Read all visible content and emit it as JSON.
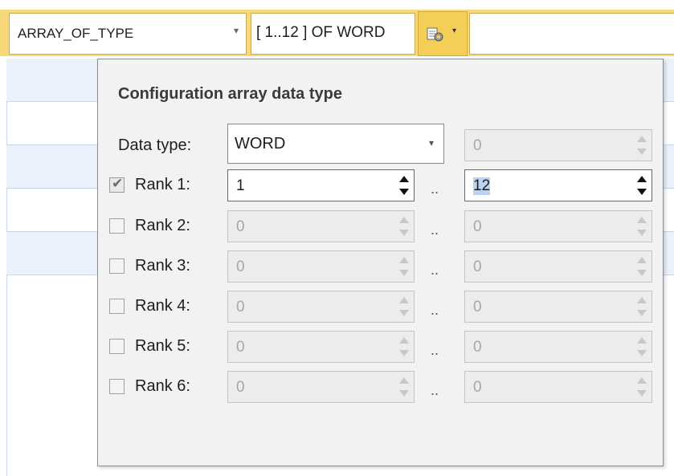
{
  "toolbar": {
    "type_value": "ARRAY_OF_TYPE",
    "type_arrow": "▾",
    "summary_value": "[ 1..12 ] OF WORD",
    "config_icon": "array-config-icon",
    "config_arrow": "▾"
  },
  "popup": {
    "title": "Configuration array data type",
    "data_type_label": "Data type:",
    "data_type_value": "WORD",
    "data_type_arrow": "▾",
    "data_type_extra_value": "0",
    "range_separator": "..",
    "ranks": [
      {
        "label": "Rank 1:",
        "checked": true,
        "lower": "1",
        "upper": "12"
      },
      {
        "label": "Rank 2:",
        "checked": false,
        "lower": "0",
        "upper": "0"
      },
      {
        "label": "Rank 3:",
        "checked": false,
        "lower": "0",
        "upper": "0"
      },
      {
        "label": "Rank 4:",
        "checked": false,
        "lower": "0",
        "upper": "0"
      },
      {
        "label": "Rank 5:",
        "checked": false,
        "lower": "0",
        "upper": "0"
      },
      {
        "label": "Rank 6:",
        "checked": false,
        "lower": "0",
        "upper": "0"
      }
    ]
  },
  "colors": {
    "toolbar_accent": "#f4cf57",
    "grid_line": "#c8d6e8",
    "splitter": "#3db86a",
    "selection": "#b9d3f3"
  }
}
